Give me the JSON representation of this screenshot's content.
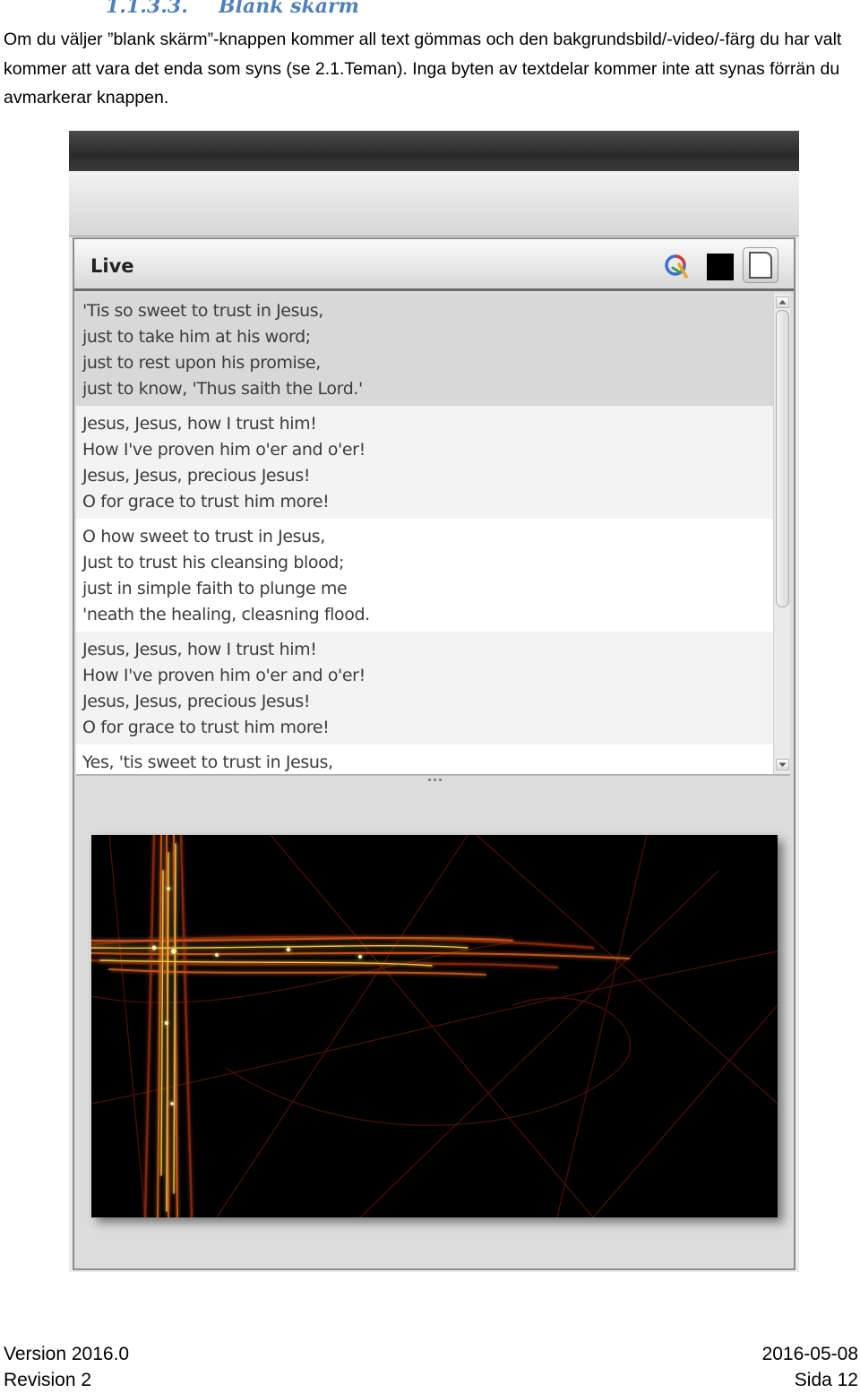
{
  "section": {
    "number": "1.1.3.3.",
    "title": "Blank skärm",
    "paragraph": "Om du väljer ”blank skärm”-knappen kommer all text gömmas och den bakgrundsbild/-video/-färg du har valt kommer att vara det enda som syns (se 2.1.Teman). Inga byten av textdelar kommer inte att synas förrän du avmarkerar knappen."
  },
  "screenshot": {
    "panel_title": "Live",
    "buttons": {
      "logo": "logo-icon",
      "black_screen": "black-screen-icon",
      "blank_screen": "blank-screen-icon"
    },
    "verses": [
      {
        "lines": [
          "'Tis so sweet to trust in Jesus,",
          "just to take him at his word;",
          "just to rest upon his promise,",
          "just to know, 'Thus saith the Lord.'"
        ],
        "state": "selected"
      },
      {
        "lines": [
          "Jesus, Jesus, how I trust him!",
          "How I've proven him o'er and o'er!",
          "Jesus, Jesus, precious Jesus!",
          "O for grace to trust him more!"
        ],
        "state": "alt"
      },
      {
        "lines": [
          "O how sweet to trust in Jesus,",
          "Just to trust his cleansing blood;",
          "just in simple faith to plunge me",
          "'neath the healing, cleasning flood."
        ],
        "state": "normal"
      },
      {
        "lines": [
          "Jesus, Jesus, how I trust him!",
          "How I've proven him o'er and o'er!",
          "Jesus, Jesus, precious Jesus!",
          "O for grace to trust him more!"
        ],
        "state": "alt"
      },
      {
        "lines": [
          "Yes, 'tis sweet to trust in Jesus,"
        ],
        "state": "normal"
      }
    ],
    "preview_background": "cross-light-streaks"
  },
  "footer": {
    "version": "Version 2016.0",
    "revision": "Revision 2",
    "date": "2016-05-08",
    "page": "Sida 12"
  },
  "colors": {
    "heading": "#4f81bd",
    "selected_row": "#d8d8d8",
    "alt_row": "#f3f3f3",
    "cross_glow": "#f5c040"
  }
}
